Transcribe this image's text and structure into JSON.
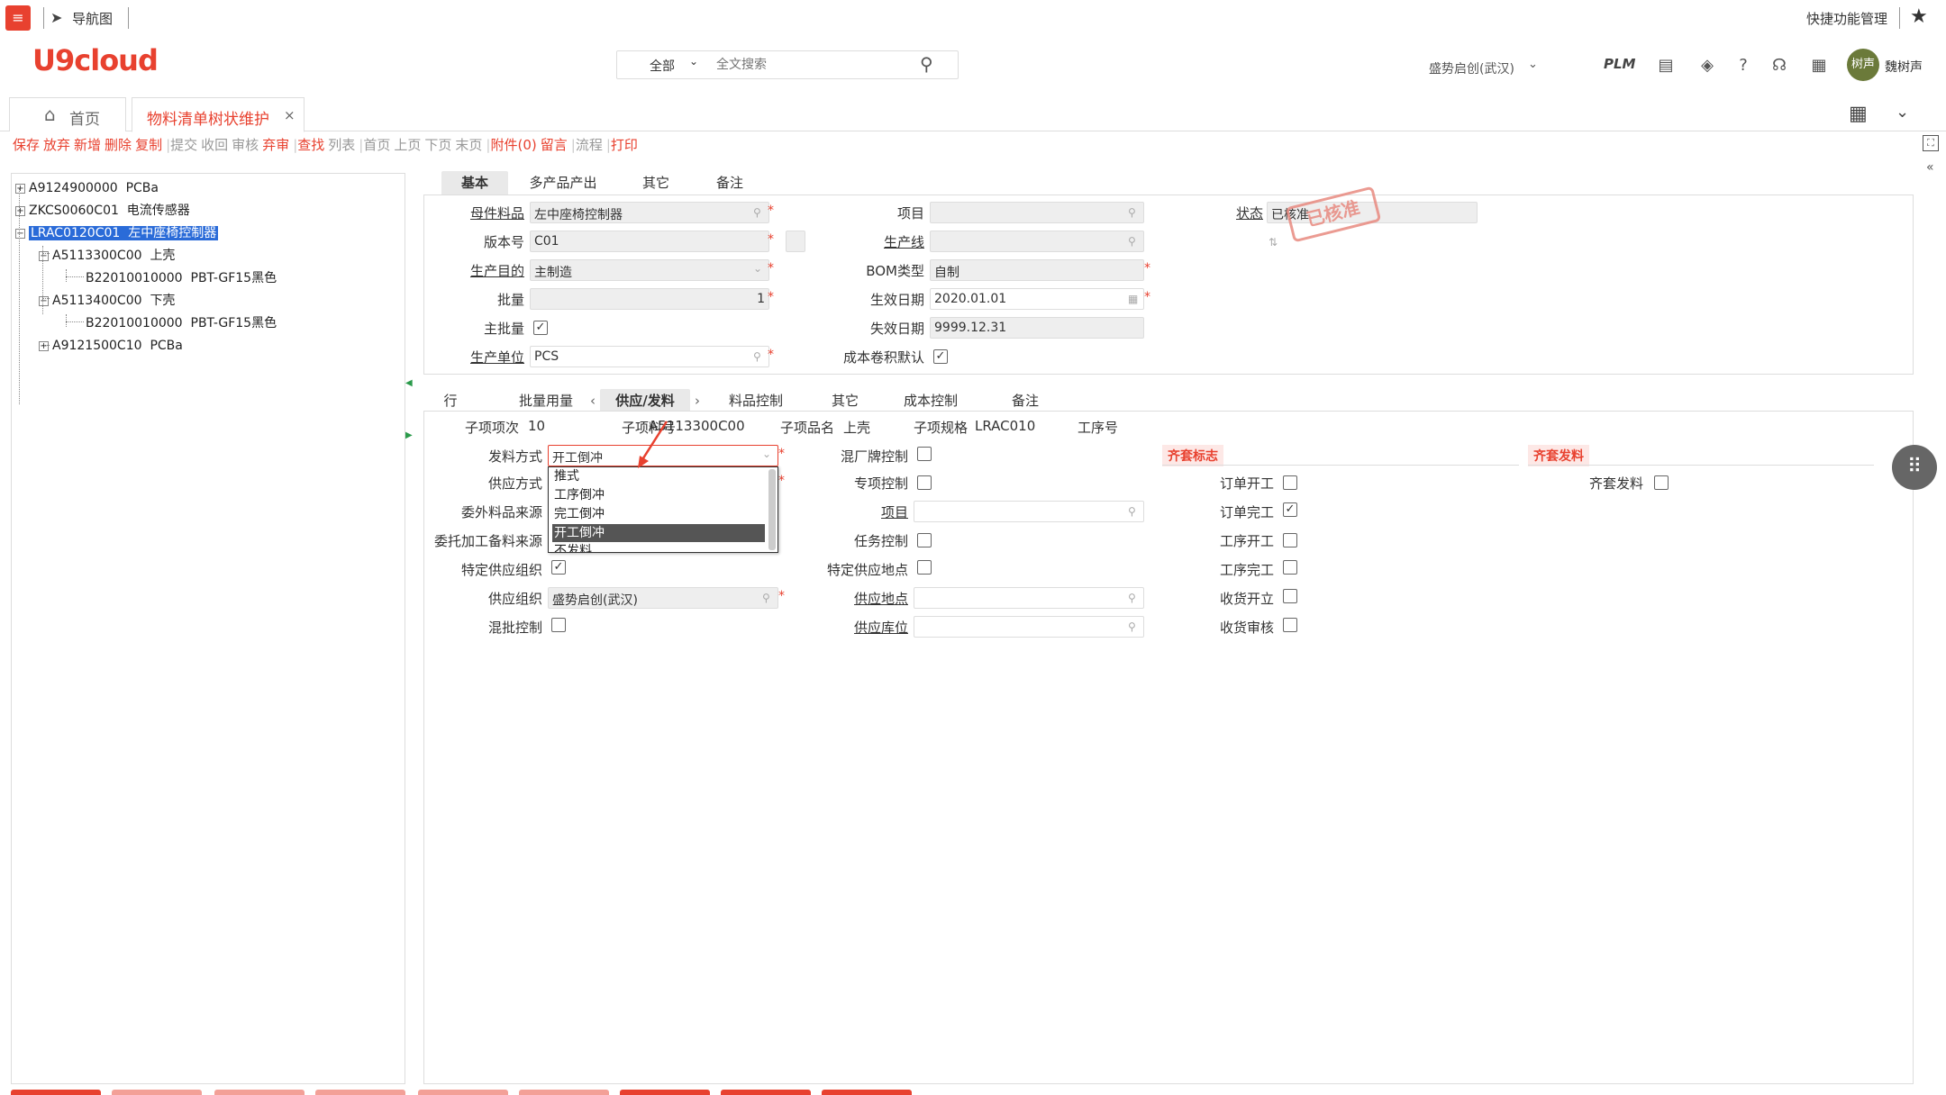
{
  "topbar": {
    "nav_label": "导航图",
    "quick_label": "快捷功能管理"
  },
  "brand": {
    "logo": "U9cloud",
    "accent": "#e8412f"
  },
  "search": {
    "scope": "全部",
    "placeholder": "全文搜索"
  },
  "header": {
    "org": "盛势启创(武汉)",
    "plm": "PLM",
    "avatar_text": "树声",
    "user_name": "魏树声"
  },
  "tabs": {
    "home": "首页",
    "bom": "物料清单树状维护"
  },
  "toolbar": [
    {
      "label": "保存",
      "enabled": true
    },
    {
      "label": "放弃",
      "enabled": true
    },
    {
      "label": "新增",
      "enabled": true
    },
    {
      "label": "删除",
      "enabled": true
    },
    {
      "label": "复制",
      "enabled": true
    },
    {
      "label": "提交",
      "enabled": false
    },
    {
      "label": "收回",
      "enabled": false
    },
    {
      "label": "审核",
      "enabled": false
    },
    {
      "label": "弃审",
      "enabled": true
    },
    {
      "label": "查找",
      "enabled": true
    },
    {
      "label": "列表",
      "enabled": false
    },
    {
      "label": "首页",
      "enabled": false
    },
    {
      "label": "上页",
      "enabled": false
    },
    {
      "label": "下页",
      "enabled": false
    },
    {
      "label": "末页",
      "enabled": false
    },
    {
      "label": "附件(0)",
      "enabled": true
    },
    {
      "label": "留言",
      "enabled": true
    },
    {
      "label": "流程",
      "enabled": false
    },
    {
      "label": "打印",
      "enabled": true
    }
  ],
  "tree": [
    {
      "code": "A9124900000",
      "name": "PCBa"
    },
    {
      "code": "ZKCS0060C01",
      "name": "电流传感器"
    },
    {
      "code": "LRAC0120C01",
      "name": "左中座椅控制器"
    },
    {
      "code": "A5113300C00",
      "name": "上壳"
    },
    {
      "code": "B22010010000",
      "name": "PBT-GF15黑色"
    },
    {
      "code": "A5113400C00",
      "name": "下壳"
    },
    {
      "code": "B22010010000",
      "name": "PBT-GF15黑色"
    },
    {
      "code": "A9121500C10",
      "name": "PCBa"
    }
  ],
  "form_tabs": [
    "基本",
    "多产品产出",
    "其它",
    "备注"
  ],
  "form": {
    "parent_item_label": "母件料品",
    "parent_item": "左中座椅控制器",
    "version_label": "版本号",
    "version": "C01",
    "purpose_label": "生产目的",
    "purpose": "主制造",
    "batch_label": "批量",
    "batch": "1",
    "main_batch_label": "主批量",
    "unit_label": "生产单位",
    "unit": "PCS",
    "project_label": "项目",
    "line_label": "生产线",
    "bom_type_label": "BOM类型",
    "bom_type": "自制",
    "effective_label": "生效日期",
    "effective": "2020.01.01",
    "expire_label": "失效日期",
    "expire": "9999.12.31",
    "cost_default_label": "成本卷积默认",
    "status_label": "状态",
    "status": "已核准",
    "stamp": "已核准"
  },
  "detail_tabs": [
    "行",
    "批量用量",
    "供应/发料",
    "料品控制",
    "其它",
    "成本控制",
    "备注"
  ],
  "detail": {
    "sub_seq_label": "子项项次",
    "sub_seq": "10",
    "sub_code_label": "子项料号",
    "sub_code": "A5113300C00",
    "sub_name_label": "子项品名",
    "sub_name": "上壳",
    "sub_spec_label": "子项规格",
    "sub_spec": "LRAC010",
    "op_no_label": "工序号",
    "issue_method_label": "发料方式",
    "issue_method": "开工倒冲",
    "supply_method_label": "供应方式",
    "outsource_src_label": "委外料品来源",
    "outsource_mat_label": "委托加工备料来源",
    "specific_org_label": "特定供应组织",
    "supply_org_label": "供应组织",
    "supply_org": "盛势启创(武汉)",
    "mixed_batch_label": "混批控制",
    "mixed_brand_label": "混厂牌控制",
    "special_ctrl_label": "专项控制",
    "project_label": "项目",
    "task_ctrl_label": "任务控制",
    "specific_loc_label": "特定供应地点",
    "supply_loc_label": "供应地点",
    "supply_wh_label": "供应库位",
    "kit_flag_header": "齐套标志",
    "kit_issue_header": "齐套发料",
    "order_start_label": "订单开工",
    "order_done_label": "订单完工",
    "op_start_label": "工序开工",
    "op_done_label": "工序完工",
    "recv_start_label": "收货开立",
    "recv_audit_label": "收货审核",
    "kit_issue_label": "齐套发料"
  },
  "dropdown_options": [
    "推式",
    "工序倒冲",
    "完工倒冲",
    "开工倒冲",
    "不发料"
  ],
  "dropdown_selected": 3
}
